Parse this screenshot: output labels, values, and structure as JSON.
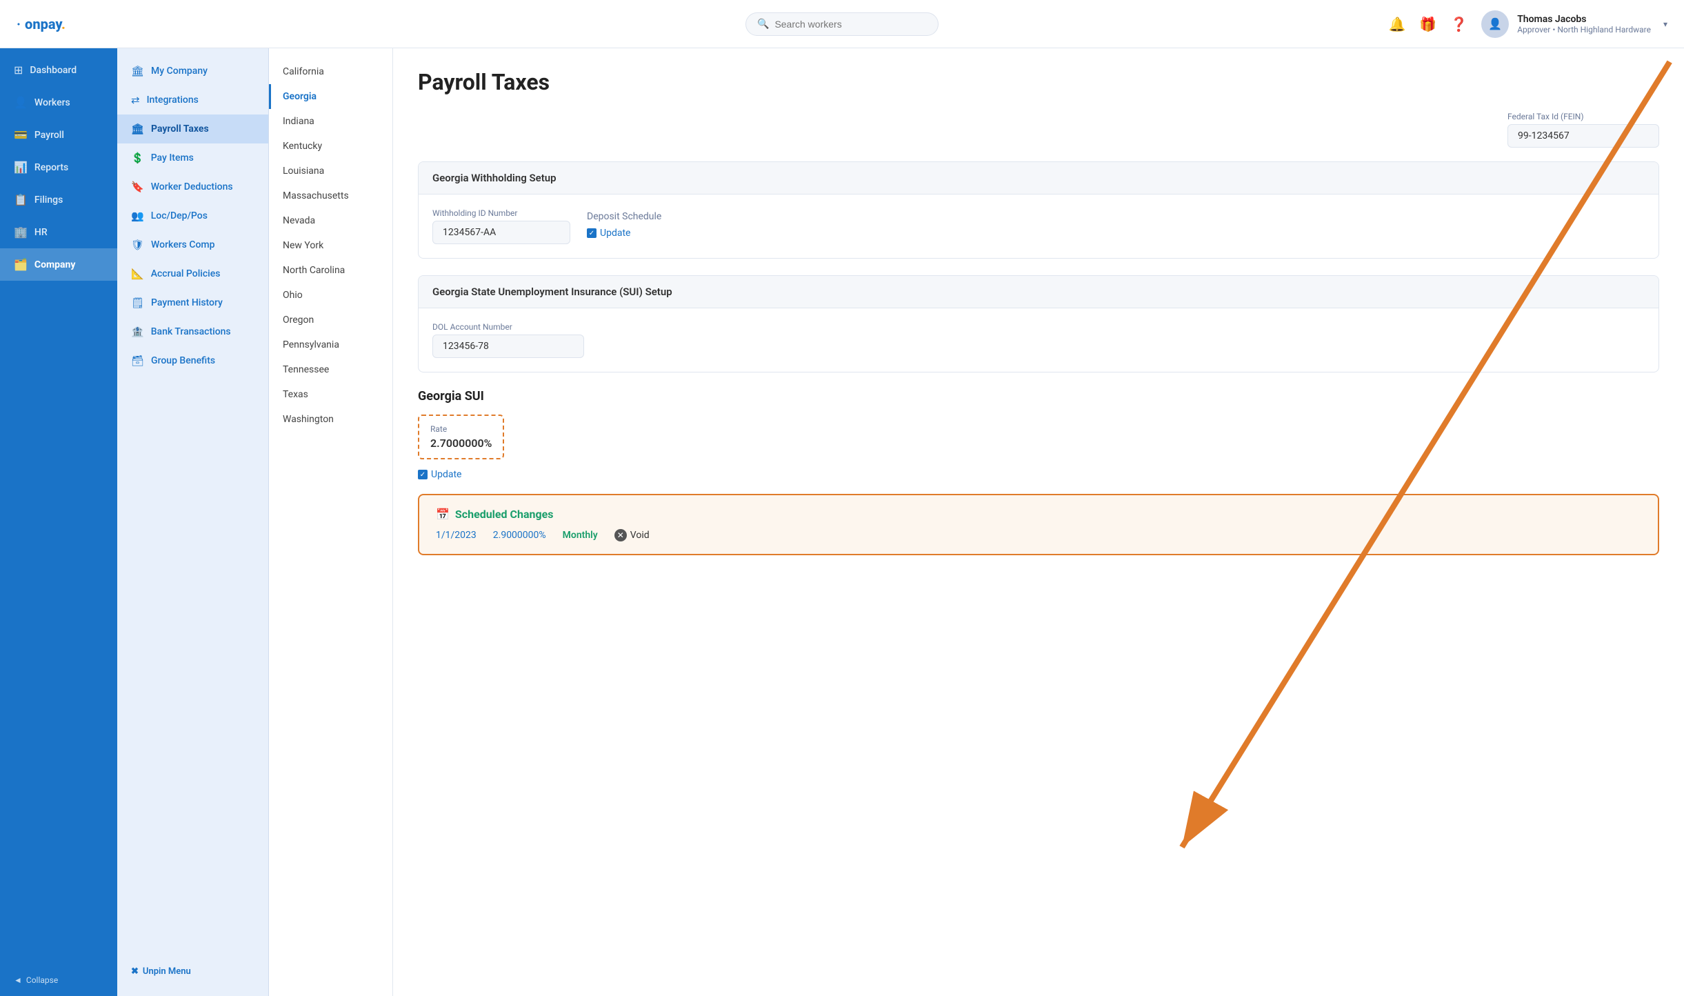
{
  "app": {
    "logo": "·onpay.",
    "logo_dot": "·"
  },
  "topnav": {
    "search_placeholder": "Search workers",
    "user_name": "Thomas Jacobs",
    "user_role": "Approver • North Highland Hardware",
    "chevron": "▾"
  },
  "sidebar": {
    "items": [
      {
        "id": "dashboard",
        "label": "Dashboard",
        "icon": "⊞"
      },
      {
        "id": "workers",
        "label": "Workers",
        "icon": "👤"
      },
      {
        "id": "payroll",
        "label": "Payroll",
        "icon": "💳"
      },
      {
        "id": "reports",
        "label": "Reports",
        "icon": "📊"
      },
      {
        "id": "filings",
        "label": "Filings",
        "icon": "📋"
      },
      {
        "id": "hr",
        "label": "HR",
        "icon": "🏢"
      },
      {
        "id": "company",
        "label": "Company",
        "icon": "🗂️",
        "active": true
      }
    ],
    "collapse_label": "◄ Collapse"
  },
  "second_sidebar": {
    "items": [
      {
        "id": "my-company",
        "label": "My Company",
        "icon": "🏛"
      },
      {
        "id": "integrations",
        "label": "Integrations",
        "icon": "⇄"
      },
      {
        "id": "payroll-taxes",
        "label": "Payroll Taxes",
        "icon": "🏛",
        "active": true
      },
      {
        "id": "pay-items",
        "label": "Pay Items",
        "icon": "💲"
      },
      {
        "id": "worker-deductions",
        "label": "Worker Deductions",
        "icon": "🔖"
      },
      {
        "id": "loc-dep-pos",
        "label": "Loc/Dep/Pos",
        "icon": "👥"
      },
      {
        "id": "workers-comp",
        "label": "Workers Comp",
        "icon": "🛡"
      },
      {
        "id": "accrual-policies",
        "label": "Accrual Policies",
        "icon": "📐"
      },
      {
        "id": "payment-history",
        "label": "Payment History",
        "icon": "🗒"
      },
      {
        "id": "bank-transactions",
        "label": "Bank Transactions",
        "icon": "🏦"
      },
      {
        "id": "group-benefits",
        "label": "Group Benefits",
        "icon": "🗃"
      }
    ],
    "unpin_label": "Unpin Menu"
  },
  "states": [
    {
      "id": "california",
      "label": "California"
    },
    {
      "id": "georgia",
      "label": "Georgia",
      "active": true
    },
    {
      "id": "indiana",
      "label": "Indiana"
    },
    {
      "id": "kentucky",
      "label": "Kentucky"
    },
    {
      "id": "louisiana",
      "label": "Louisiana"
    },
    {
      "id": "massachusetts",
      "label": "Massachusetts"
    },
    {
      "id": "nevada",
      "label": "Nevada"
    },
    {
      "id": "new-york",
      "label": "New York"
    },
    {
      "id": "north-carolina",
      "label": "North Carolina"
    },
    {
      "id": "ohio",
      "label": "Ohio"
    },
    {
      "id": "oregon",
      "label": "Oregon"
    },
    {
      "id": "pennsylvania",
      "label": "Pennsylvania"
    },
    {
      "id": "tennessee",
      "label": "Tennessee"
    },
    {
      "id": "texas",
      "label": "Texas"
    },
    {
      "id": "washington",
      "label": "Washington"
    }
  ],
  "page": {
    "title": "Payroll Taxes",
    "fein_label": "Federal Tax Id (FEIN)",
    "fein_value": "99-1234567",
    "withholding_section_title": "Georgia Withholding Setup",
    "withholding_id_label": "Withholding ID Number",
    "withholding_id_value": "1234567-AA",
    "deposit_schedule_label": "Deposit Schedule",
    "update_label": "Update",
    "sui_section_title": "Georgia State Unemployment Insurance (SUI) Setup",
    "dol_account_label": "DOL Account Number",
    "dol_account_value": "123456-78",
    "georgia_sui_title": "Georgia SUI",
    "rate_label": "Rate",
    "rate_value": "2.7000000%",
    "sui_update_label": "Update",
    "scheduled_changes_title": "Scheduled Changes",
    "scheduled_icon": "📅",
    "scheduled_date": "1/1/2023",
    "scheduled_rate": "2.9000000%",
    "scheduled_freq": "Monthly",
    "void_label": "Void"
  }
}
